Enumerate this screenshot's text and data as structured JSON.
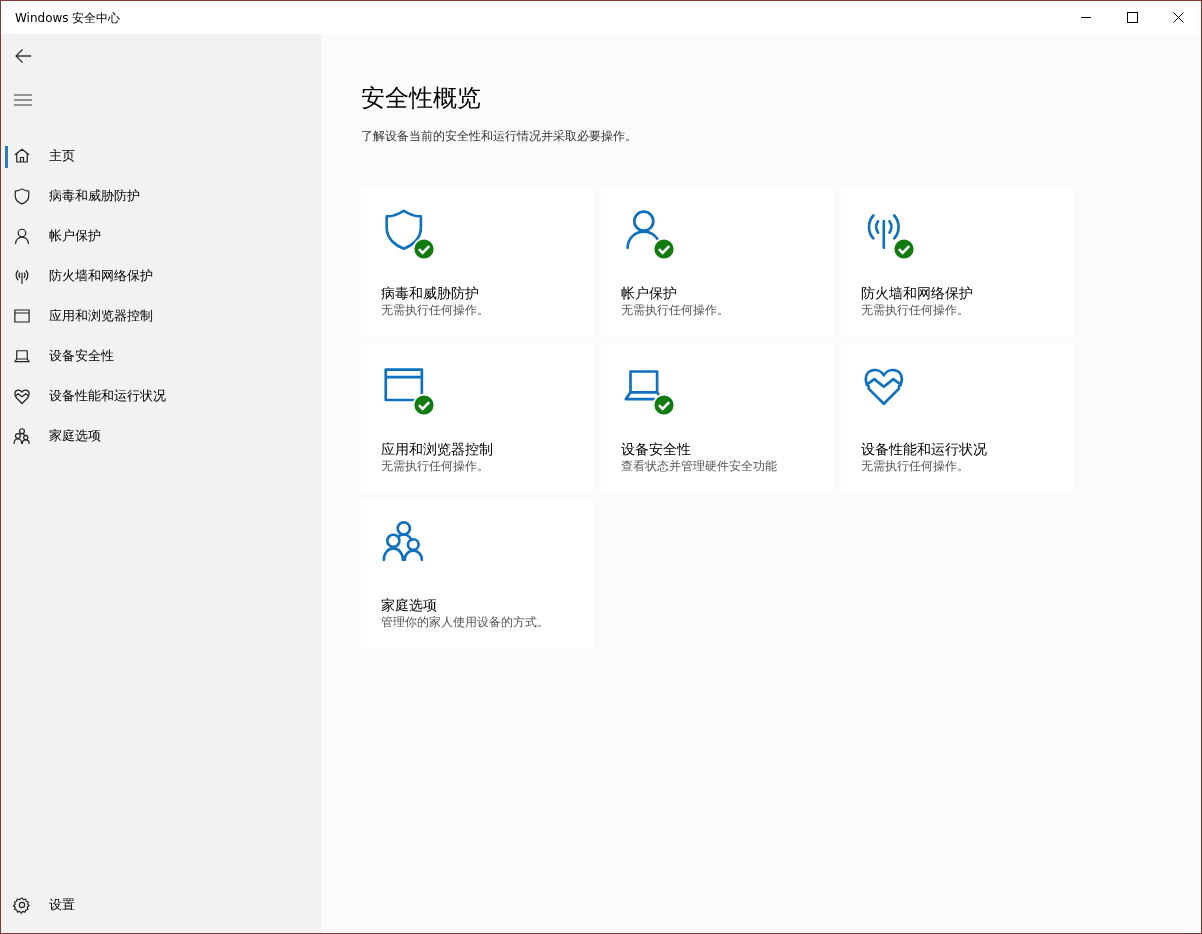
{
  "window": {
    "title": "Windows 安全中心"
  },
  "sidebar": {
    "items": [
      {
        "label": "主页",
        "kind": "home",
        "selected": true
      },
      {
        "label": "病毒和威胁防护",
        "kind": "shield",
        "selected": false
      },
      {
        "label": "帐户保护",
        "kind": "person",
        "selected": false
      },
      {
        "label": "防火墙和网络保护",
        "kind": "antenna",
        "selected": false
      },
      {
        "label": "应用和浏览器控制",
        "kind": "browser",
        "selected": false
      },
      {
        "label": "设备安全性",
        "kind": "laptop",
        "selected": false
      },
      {
        "label": "设备性能和运行状况",
        "kind": "heart",
        "selected": false
      },
      {
        "label": "家庭选项",
        "kind": "family",
        "selected": false
      }
    ],
    "footer": {
      "label": "设置"
    }
  },
  "page": {
    "title": "安全性概览",
    "subtitle": "了解设备当前的安全性和运行情况并采取必要操作。"
  },
  "tiles": [
    {
      "kind": "shield",
      "ok": true,
      "title": "病毒和威胁防护",
      "status": "无需执行任何操作。"
    },
    {
      "kind": "person",
      "ok": true,
      "title": "帐户保护",
      "status": "无需执行任何操作。"
    },
    {
      "kind": "antenna",
      "ok": true,
      "title": "防火墙和网络保护",
      "status": "无需执行任何操作。"
    },
    {
      "kind": "browser",
      "ok": true,
      "title": "应用和浏览器控制",
      "status": "无需执行任何操作。"
    },
    {
      "kind": "laptop",
      "ok": true,
      "title": "设备安全性",
      "status": "查看状态并管理硬件安全功能"
    },
    {
      "kind": "heart",
      "ok": false,
      "title": "设备性能和运行状况",
      "status": "无需执行任何操作。"
    },
    {
      "kind": "family",
      "ok": false,
      "title": "家庭选项",
      "status": "管理你的家人使用设备的方式。"
    }
  ]
}
